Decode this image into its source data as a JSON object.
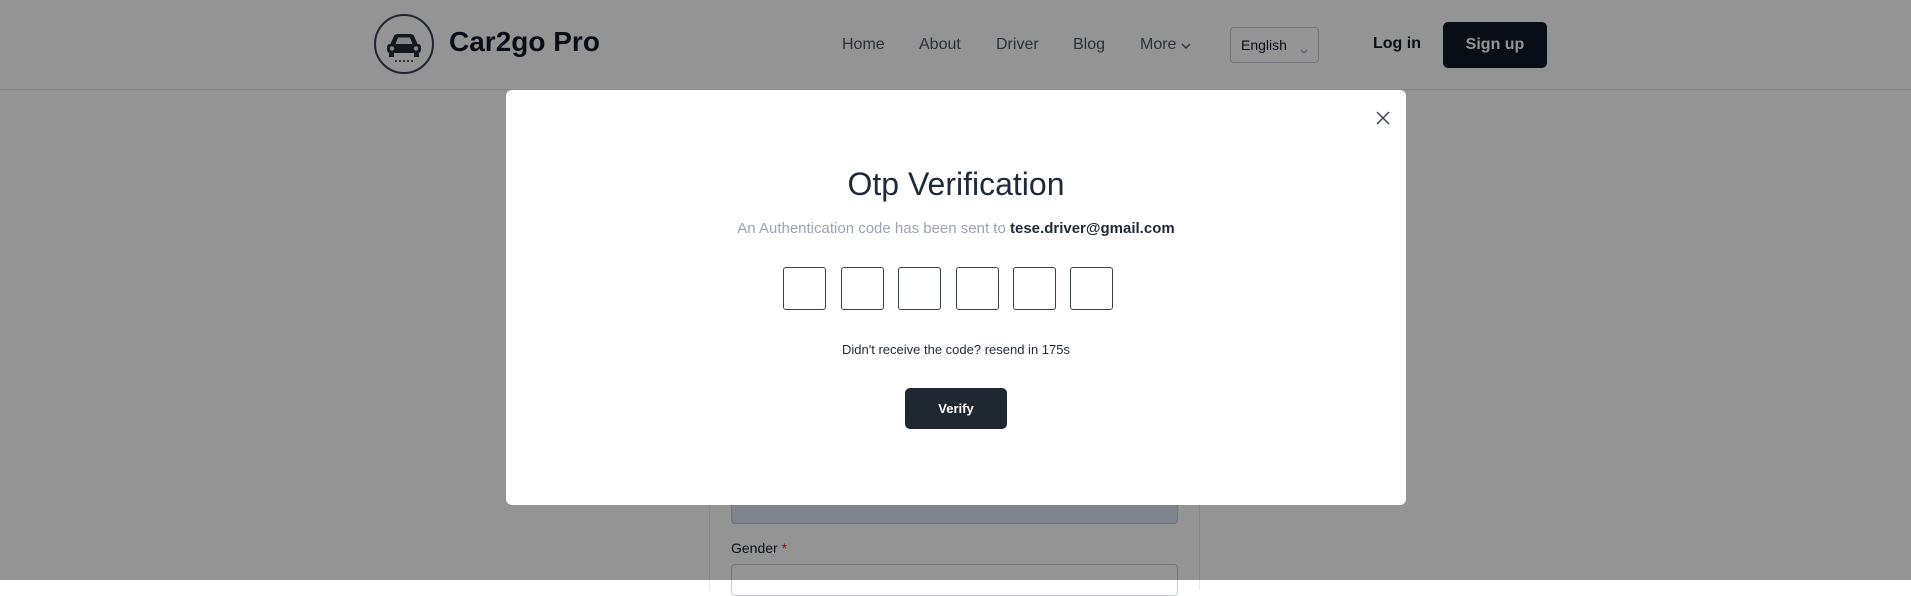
{
  "header": {
    "brand": "Car2go Pro",
    "nav": [
      "Home",
      "About",
      "Driver",
      "Blog",
      "More"
    ],
    "language": "English",
    "login": "Log in",
    "signup": "Sign up"
  },
  "form": {
    "gender_label": "Gender",
    "required_mark": "*"
  },
  "modal": {
    "title": "Otp Verification",
    "subtitle_prefix": "An Authentication code has been sent to",
    "email": "tese.driver@gmail.com",
    "otp_values": [
      "",
      "",
      "",
      "",
      "",
      ""
    ],
    "resend_text": "Didn't receive the code? resend in 175s",
    "verify_label": "Verify"
  },
  "icons": {
    "logo": "car-logo-icon",
    "more": "chevron-down-icon",
    "language": "chevron-down-icon",
    "close": "close-icon"
  },
  "colors": {
    "primary": "#111827",
    "verify_button": "#1f2730",
    "muted_text": "#9ca3af"
  }
}
